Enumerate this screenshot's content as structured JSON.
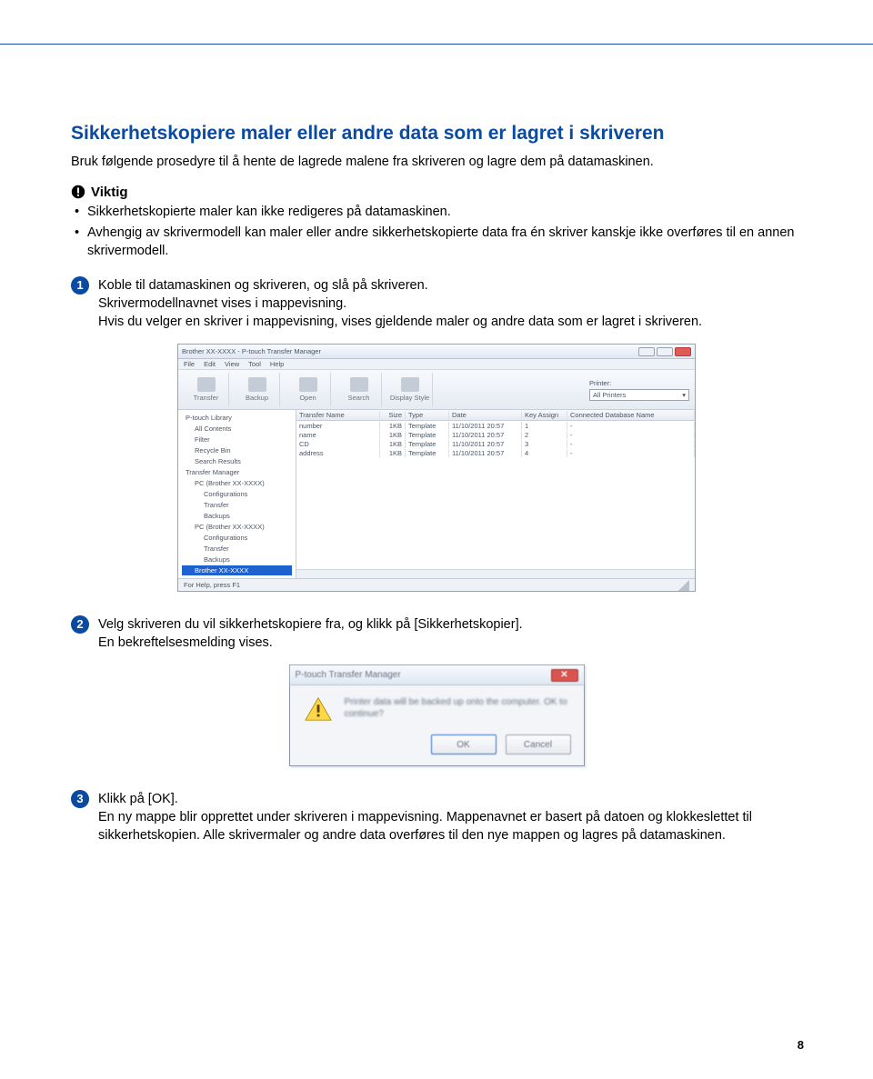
{
  "page_number": "8",
  "heading": "Sikkerhetskopiere maler eller andre data som er lagret i skriveren",
  "intro": "Bruk følgende prosedyre til å hente de lagrede malene fra skriveren og lagre dem på datamaskinen.",
  "important": {
    "title": "Viktig",
    "bullets": [
      "Sikkerhetskopierte maler kan ikke redigeres på datamaskinen.",
      "Avhengig av skrivermodell kan maler eller andre sikkerhetskopierte data fra én skriver kanskje ikke overføres til en annen skrivermodell."
    ]
  },
  "steps": [
    {
      "num": "1",
      "text": "Koble til datamaskinen og skriveren, og slå på skriveren.\nSkrivermodellnavnet vises i mappevisning.\nHvis du velger en skriver i mappevisning, vises gjeldende maler og andre data som er lagret i skriveren."
    },
    {
      "num": "2",
      "text": "Velg skriveren du vil sikkerhetskopiere fra, og klikk på [Sikkerhetskopier].\nEn bekreftelsesmelding vises."
    },
    {
      "num": "3",
      "text": "Klikk på [OK].\nEn ny mappe blir opprettet under skriveren i mappevisning. Mappenavnet er basert på datoen og klokkeslettet til sikkerhetskopien. Alle skrivermaler og andre data overføres til den nye mappen og lagres på datamaskinen."
    }
  ],
  "app": {
    "title": "Brother XX-XXXX - P-touch Transfer Manager",
    "menus": [
      "File",
      "Edit",
      "View",
      "Tool",
      "Help"
    ],
    "toolbar": [
      "Transfer",
      "Backup",
      "Open",
      "Search",
      "Display Style"
    ],
    "printer_label": "Printer:",
    "printer_value": "All Printers",
    "tree": [
      {
        "lvl": 1,
        "label": "P-touch Library"
      },
      {
        "lvl": 2,
        "label": "All Contents"
      },
      {
        "lvl": 2,
        "label": "Filter"
      },
      {
        "lvl": 2,
        "label": "Recycle Bin"
      },
      {
        "lvl": 2,
        "label": "Search Results"
      },
      {
        "lvl": 1,
        "label": "Transfer Manager"
      },
      {
        "lvl": 2,
        "label": "PC (Brother XX-XXXX)"
      },
      {
        "lvl": 3,
        "label": "Configurations"
      },
      {
        "lvl": 3,
        "label": "Transfer"
      },
      {
        "lvl": 3,
        "label": "Backups"
      },
      {
        "lvl": 2,
        "label": "PC (Brother XX-XXXX)"
      },
      {
        "lvl": 3,
        "label": "Configurations"
      },
      {
        "lvl": 3,
        "label": "Transfer"
      },
      {
        "lvl": 3,
        "label": "Backups"
      },
      {
        "lvl": 2,
        "label": "Brother XX-XXXX",
        "selected": true
      }
    ],
    "columns": [
      "Transfer Name",
      "Size",
      "Type",
      "Date",
      "Key Assign",
      "Connected Database Name"
    ],
    "rows": [
      {
        "name": "number",
        "size": "1KB",
        "type": "Template",
        "date": "11/10/2011 20:57",
        "key": "1",
        "db": "-"
      },
      {
        "name": "name",
        "size": "1KB",
        "type": "Template",
        "date": "11/10/2011 20:57",
        "key": "2",
        "db": "-"
      },
      {
        "name": "CD",
        "size": "1KB",
        "type": "Template",
        "date": "11/10/2011 20:57",
        "key": "3",
        "db": "-"
      },
      {
        "name": "address",
        "size": "1KB",
        "type": "Template",
        "date": "11/10/2011 20:57",
        "key": "4",
        "db": "-"
      }
    ],
    "status": "For Help, press F1"
  },
  "dialog": {
    "title": "P-touch Transfer Manager",
    "message": "Printer data will be backed up onto the computer. OK to continue?",
    "ok": "OK",
    "cancel": "Cancel"
  }
}
